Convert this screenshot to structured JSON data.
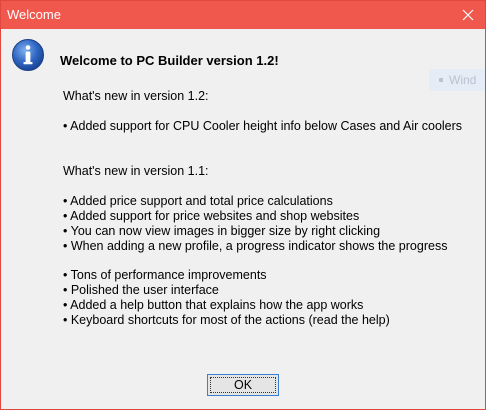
{
  "window": {
    "title": "Welcome"
  },
  "dialog": {
    "heading": "Welcome to PC Builder version 1.2!",
    "v12_title": "What's new in version 1.2:",
    "v12_items": [
      "• Added support for CPU Cooler height info below Cases and Air coolers"
    ],
    "v11_title": "What's new in version 1.1:",
    "v11_group1": [
      "• Added price support and total price calculations",
      "• Added support for price websites and shop websites",
      "• You can now view images in bigger size by right clicking",
      "• When adding a new profile, a progress indicator shows the progress"
    ],
    "v11_group2": [
      "• Tons of performance improvements",
      "• Polished the user interface",
      "• Added a help button that explains how the app works",
      "• Keyboard shortcuts for most of the actions (read the help)"
    ],
    "ok_label": "OK"
  },
  "background_window": {
    "partial_title": "Wind"
  },
  "icons": {
    "info": "info-icon",
    "close": "close-icon"
  },
  "colors": {
    "titlebar": "#f0574d",
    "border": "#e0473f",
    "dialog_bg": "#f0f0f0",
    "info_icon": "#2c5fb5",
    "ok_border": "#3c7fd1"
  }
}
